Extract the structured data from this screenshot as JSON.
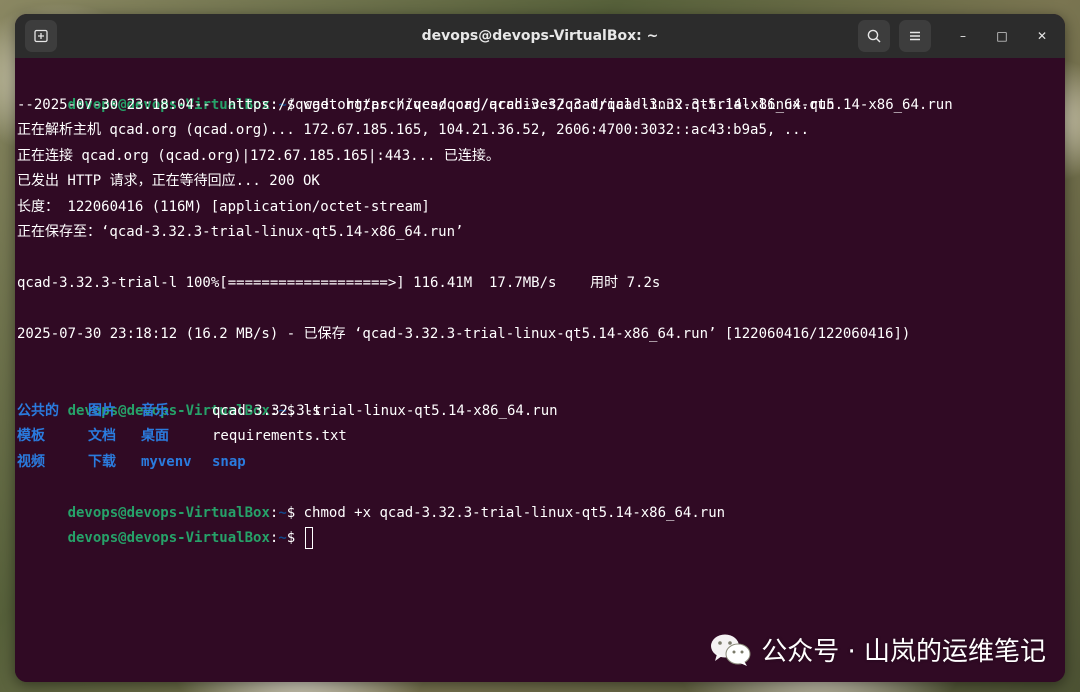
{
  "window": {
    "title": "devops@devops-VirtualBox: ~",
    "new_tab_icon": "new-tab-icon",
    "search_icon": "search-icon",
    "menu_icon": "hamburger-menu-icon",
    "minimize_glyph": "–",
    "maximize_glyph": "□",
    "close_glyph": "✕"
  },
  "terminal": {
    "prompt_user": "devops@devops-VirtualBox",
    "prompt_sep": ":",
    "prompt_path": "~",
    "prompt_symbol": "$ ",
    "cmd_wget": "wget https://qcad.org/archives/qcad/qcad-3.32.3-trial-linux-qt5.14-x86_64.run",
    "out_1": "--2025-07-30 23:18:04--  https://qcad.org/archives/qcad/qcad-3.32.3-trial-linux-qt5.14-x86_64.run",
    "out_2": "正在解析主机 qcad.org (qcad.org)... 172.67.185.165, 104.21.36.52, 2606:4700:3032::ac43:b9a5, ...",
    "out_3": "正在连接 qcad.org (qcad.org)|172.67.185.165|:443... 已连接。",
    "out_4": "已发出 HTTP 请求，正在等待回应... 200 OK",
    "out_5": "长度： 122060416 (116M) [application/octet-stream]",
    "out_6": "正在保存至：‘qcad-3.32.3-trial-linux-qt5.14-x86_64.run’",
    "out_progress": "qcad-3.32.3-trial-l 100%[===================>] 116.41M  17.7MB/s    用时 7.2s",
    "out_saved": "2025-07-30 23:18:12 (16.2 MB/s) - 已保存 ‘qcad-3.32.3-trial-linux-qt5.14-x86_64.run’ [122060416/122060416])",
    "cmd_ls": "ls",
    "ls_row1": {
      "a": "公共的",
      "b": "图片",
      "c": "音乐",
      "file": "qcad-3.32.3-trial-linux-qt5.14-x86_64.run"
    },
    "ls_row2": {
      "a": "模板",
      "b": "文档",
      "c": "桌面",
      "file": "requirements.txt"
    },
    "ls_row3": {
      "a": "视频",
      "b": "下载",
      "c": "myvenv",
      "d": "snap"
    },
    "cmd_chmod": "chmod +x qcad-3.32.3-trial-linux-qt5.14-x86_64.run"
  },
  "watermark": {
    "text": "公众号 · 山岚的运维笔记",
    "icon": "wechat-icon"
  },
  "colors": {
    "terminal_bg": "#300a24",
    "titlebar_bg": "#2c2c2c",
    "prompt_user": "#26a269",
    "prompt_path": "#12488b",
    "directory": "#2a7bde"
  }
}
